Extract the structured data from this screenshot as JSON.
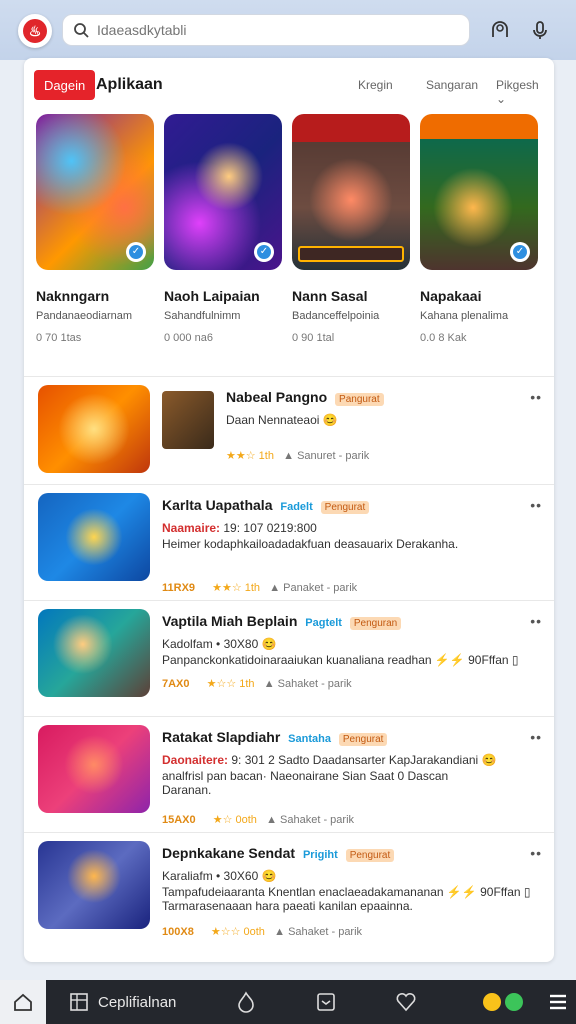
{
  "header": {
    "search_placeholder": "Idaeasdkytabli"
  },
  "tabs": {
    "active_label": "Dagein",
    "section_title": "Aplikaan",
    "items": [
      "Kregin",
      "Sangaran",
      "Pikgesh"
    ]
  },
  "featured": [
    {
      "name": "Naknngarn",
      "sub": "Pandanaeodiarnam",
      "meta": "0 70 1tas"
    },
    {
      "name": "Naoh Laipaian",
      "sub": "Sahandfulnimm",
      "meta": "0 000 na6"
    },
    {
      "name": "Nann Sasal",
      "sub": "Badanceffelpoinia",
      "meta": "0 90 1tal"
    },
    {
      "name": "Napakaai",
      "sub": "Kahana plenalima",
      "meta": "0.0 8 Kak"
    }
  ],
  "list": [
    {
      "title": "Nabeal Pangno",
      "badge_blue": "",
      "badge_orange": "Pangurat",
      "line1_red": "",
      "line1": "Daan Nennateaoi 😊",
      "line2": "",
      "downloads": "",
      "rating": "★★☆ 1th",
      "size": "Sanuret - parik"
    },
    {
      "title": "Karlta Uapathala",
      "badge_blue": "Fadelt",
      "badge_orange": "Pengurat",
      "line1_red": "Naamaire:",
      "line1": "19: 107  0219:800",
      "line2": "Heimer kodaphkailoadadakfuan deasauarix Derakanha.",
      "downloads": "11RX9",
      "rating": "★★☆ 1th",
      "size": "Panaket - parik"
    },
    {
      "title": "Vaptila Miah Beplain",
      "badge_blue": "Pagtelt",
      "badge_orange": "Penguran",
      "line1_red": "",
      "line1": "Kadolfam • 30X80 😊",
      "line2": "Panpanckonkatidoinaraaiukan kuanaliana readhan ⚡⚡ 90Fffan ▯",
      "downloads": "7AX0",
      "rating": "★☆☆ 1th",
      "size": "Sahaket - parik"
    },
    {
      "title": "Ratakat Slapdiahr",
      "badge_blue": "Santaha",
      "badge_orange": "Pengurat",
      "line1_red": "Daonaitere:",
      "line1": "9: 301 2 Sadto Daadansarter KapJarakandiani 😊",
      "line2": "analfrisl pan bacan· Naeonairane Sian Saat 0 Dascan  Daranan.",
      "downloads": "15AX0",
      "rating": "★☆ 0oth",
      "size": "Sahaket - parik"
    },
    {
      "title": "Depnkakane Sendat",
      "badge_blue": "Prigiht",
      "badge_orange": "Pengurat",
      "line1_red": "",
      "line1": "Karaliafm • 30X60 😊",
      "line2": "Tampafudeiaaranta Knentlan enaclaeadakamananan ⚡⚡ 90Fffan ▯  Tarmarasenaaan hara paeati kanilan epaainna.",
      "downloads": "100X8",
      "rating": "★☆☆ 0oth",
      "size": "Sahaket - parik"
    }
  ],
  "bottom_nav": {
    "label": "Ceplifialnan"
  },
  "colors": {
    "accent_red": "#e5232a",
    "badge_blue": "#1a9ad9",
    "badge_orange_bg": "#fcd9b4"
  }
}
